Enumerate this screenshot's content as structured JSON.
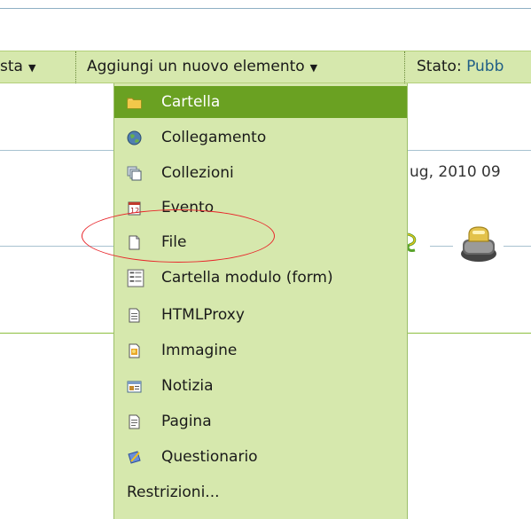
{
  "toolbar": {
    "left_fragment": "sta",
    "add_menu_label": "Aggiungi un nuovo elemento",
    "state_label": "Stato:",
    "state_value": "Pubb",
    "dropdown_arrow": "▼"
  },
  "menu": {
    "items": [
      {
        "label": "Cartella",
        "icon": "folder-icon",
        "selected": true
      },
      {
        "label": "Collegamento",
        "icon": "globe-link-icon"
      },
      {
        "label": "Collezioni",
        "icon": "collection-icon"
      },
      {
        "label": "Evento",
        "icon": "calendar-icon"
      },
      {
        "label": "File",
        "icon": "file-icon"
      },
      {
        "label": "Cartella modulo (form)",
        "icon": "form-folder-icon"
      },
      {
        "label": "HTMLProxy",
        "icon": "html-document-icon"
      },
      {
        "label": "Immagine",
        "icon": "image-icon"
      },
      {
        "label": "Notizia",
        "icon": "news-icon"
      },
      {
        "label": "Pagina",
        "icon": "page-icon"
      },
      {
        "label": "Questionario",
        "icon": "questionnaire-icon"
      },
      {
        "label": "Restrizioni..."
      }
    ]
  },
  "background": {
    "date_fragment": "ug, 2010 09"
  },
  "colors": {
    "toolbar_bg": "#d6e8ad",
    "selected_bg": "#6aa122",
    "highlight_circle": "#e8262b",
    "link_blue": "#1f5e86"
  }
}
